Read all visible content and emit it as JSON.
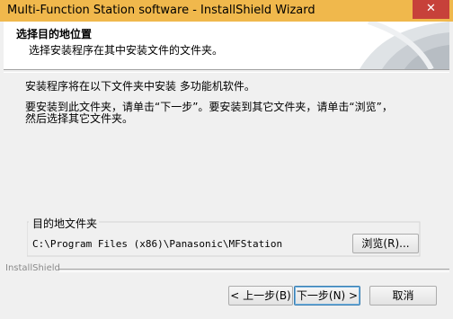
{
  "window": {
    "title": "Multi-Function Station software - InstallShield Wizard",
    "close_glyph": "✕"
  },
  "header": {
    "title": "选择目的地位置",
    "subtitle": "选择安装程序在其中安装文件的文件夹。"
  },
  "body": {
    "line1": "安装程序将在以下文件夹中安装 多功能机软件。",
    "line2": "要安装到此文件夹，请单击“下一步”。要安装到其它文件夹，请单击“浏览”，",
    "line3": "然后选择其它文件夹。"
  },
  "destination": {
    "group_label": "目的地文件夹",
    "path": "C:\\Program Files (x86)\\Panasonic\\MFStation",
    "browse_label": "浏览(R)..."
  },
  "footer": {
    "brand": "InstallShield",
    "back_label": "< 上一步(B)",
    "next_label": "下一步(N) >",
    "cancel_label": "取消"
  },
  "colors": {
    "titlebar": "#f0b84c",
    "close": "#c7413a",
    "header_bg": "#ffffff",
    "dialog_bg": "#f0f0f0"
  }
}
